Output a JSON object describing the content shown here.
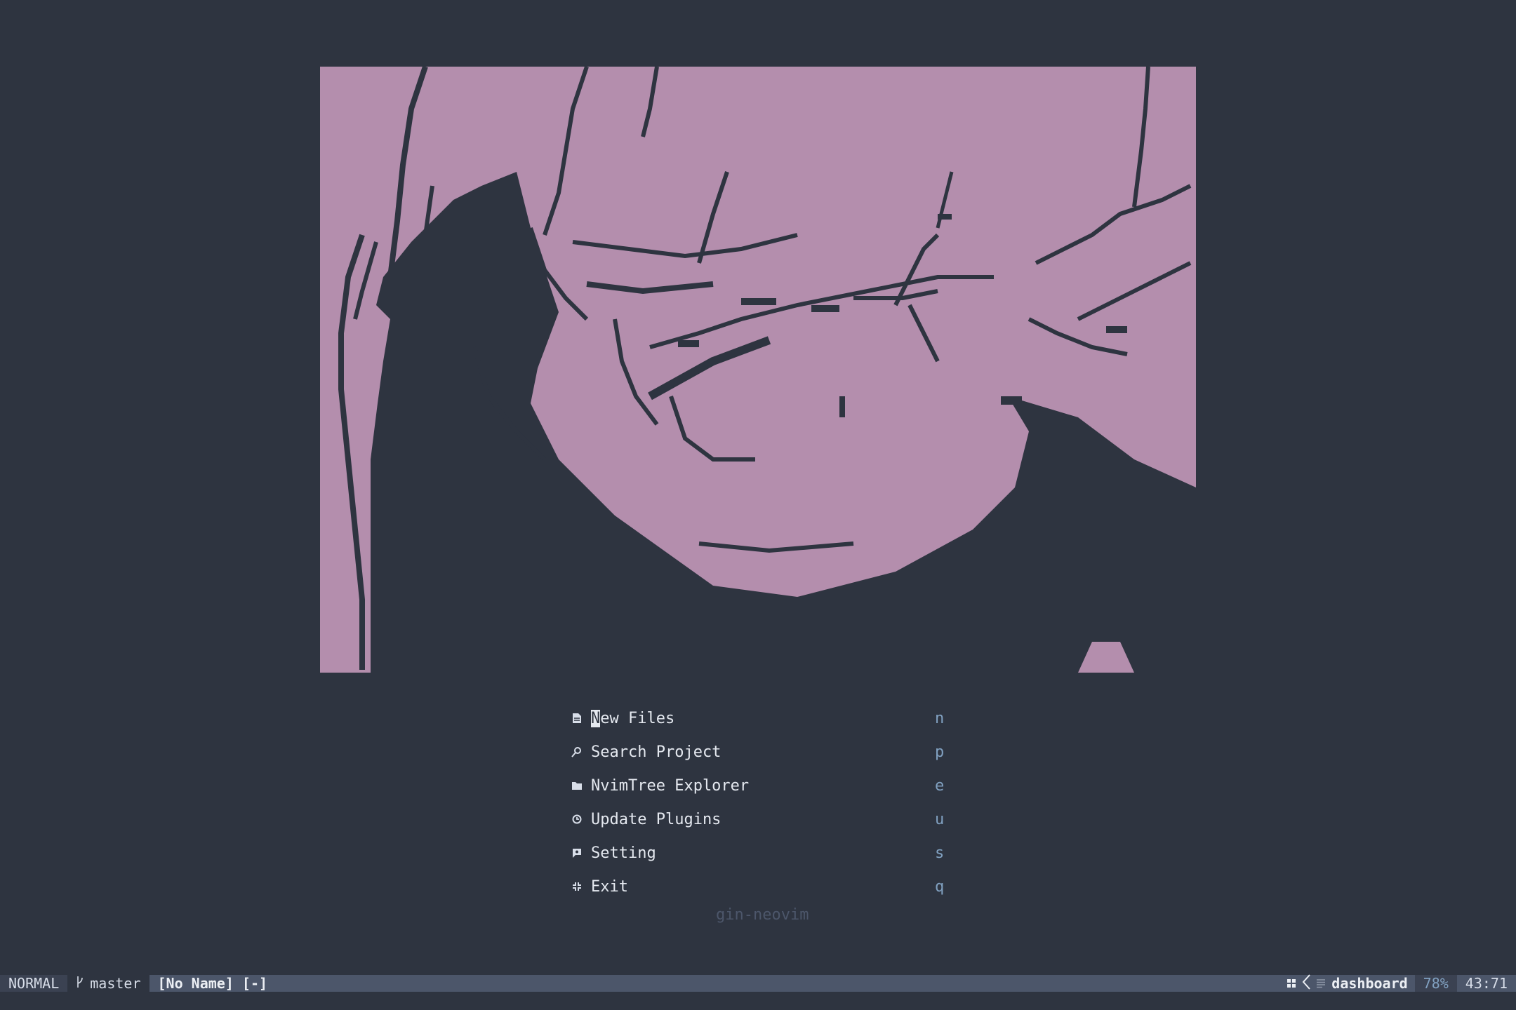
{
  "theme": {
    "background": "#2e3440",
    "art_color": "#b48ead",
    "key_color": "#81a1c1",
    "muted": "#4c566a"
  },
  "dashboard": {
    "items": [
      {
        "icon": "file-icon",
        "cursor_char": "N",
        "label_rest": "ew Files",
        "key": "n"
      },
      {
        "icon": "search-icon",
        "label": "Search Project",
        "key": "p"
      },
      {
        "icon": "folder-icon",
        "label": "NvimTree Explorer",
        "key": "e"
      },
      {
        "icon": "refresh-icon",
        "label": "Update Plugins",
        "key": "u"
      },
      {
        "icon": "settings-icon",
        "label": "Setting",
        "key": "s"
      },
      {
        "icon": "exit-icon",
        "label": "Exit",
        "key": "q"
      }
    ],
    "footer": "gin-neovim"
  },
  "statusline": {
    "mode": "NORMAL",
    "branch": "master",
    "file": "[No Name] [-]",
    "filetype": "dashboard",
    "percent": "78%",
    "position": "43:71"
  }
}
